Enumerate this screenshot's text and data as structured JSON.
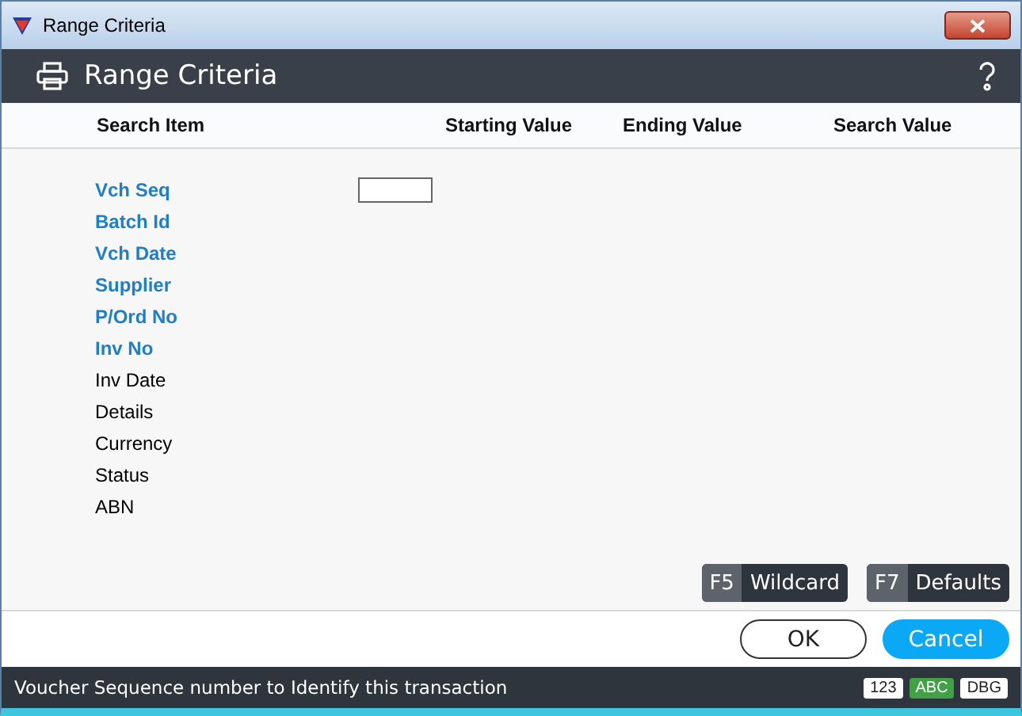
{
  "window": {
    "title": "Range Criteria"
  },
  "header": {
    "title": "Range Criteria"
  },
  "columns": [
    "Search Item",
    "Starting Value",
    "Ending Value",
    "Search Value"
  ],
  "items": [
    {
      "label": "Vch Seq",
      "highlighted": true,
      "has_input": true
    },
    {
      "label": "Batch Id",
      "highlighted": true,
      "has_input": false
    },
    {
      "label": "Vch Date",
      "highlighted": true,
      "has_input": false
    },
    {
      "label": "Supplier",
      "highlighted": true,
      "has_input": false
    },
    {
      "label": "P/Ord No",
      "highlighted": true,
      "has_input": false
    },
    {
      "label": "Inv No",
      "highlighted": true,
      "has_input": false
    },
    {
      "label": "Inv Date",
      "highlighted": false,
      "has_input": false
    },
    {
      "label": "Details",
      "highlighted": false,
      "has_input": false
    },
    {
      "label": "Currency",
      "highlighted": false,
      "has_input": false
    },
    {
      "label": "Status",
      "highlighted": false,
      "has_input": false
    },
    {
      "label": "ABN",
      "highlighted": false,
      "has_input": false
    }
  ],
  "function_keys": [
    {
      "key": "F5",
      "label": "Wildcard"
    },
    {
      "key": "F7",
      "label": "Defaults"
    }
  ],
  "buttons": [
    {
      "label": "OK",
      "primary": false
    },
    {
      "label": "Cancel",
      "primary": true
    }
  ],
  "status_bar": {
    "message": "Voucher Sequence number to Identify this transaction",
    "indicators": [
      {
        "label": "123",
        "on": false
      },
      {
        "label": "ABC",
        "on": true
      },
      {
        "label": "DBG",
        "on": false
      }
    ]
  }
}
